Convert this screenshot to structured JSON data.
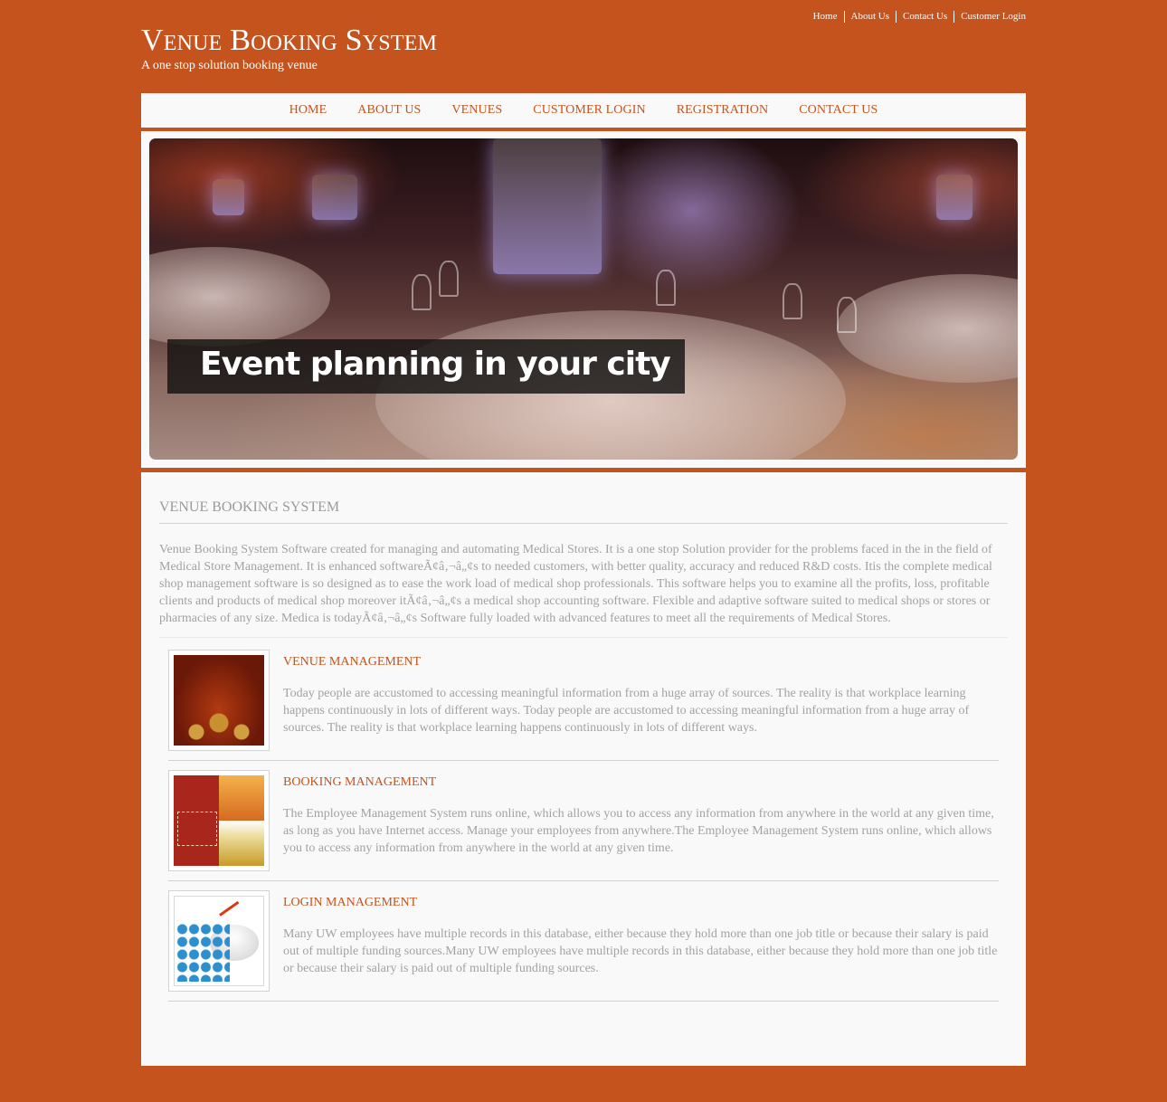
{
  "header": {
    "title": "Venue Booking System",
    "tagline": "A one stop solution booking venue",
    "top_links": [
      "Home",
      "About Us",
      "Contact Us",
      "Customer Login"
    ]
  },
  "nav": {
    "items": [
      "HOME",
      "ABOUT US",
      "VENUES",
      "CUSTOMER LOGIN",
      "REGISTRATION",
      "CONTACT US"
    ]
  },
  "banner": {
    "caption": "Event planning in your city",
    "image": "banquet-hall-photo"
  },
  "main": {
    "title": "VENUE BOOKING SYSTEM",
    "intro": "Venue Booking System Software created for managing and automating Medical Stores. It is a one stop Solution provider for the problems faced in the in the field of Medical Store Management. It is enhanced softwareÃ¢â‚¬â„¢s to needed customers, with better quality, accuracy and reduced R&D costs. Itis the complete medical shop management software is so designed as to ease the work load of medical shop professionals. This software helps you to examine all the profits, loss, profitable clients and products of medical shop moreover itÃ¢â‚¬â„¢s a medical shop accounting software. Flexible and adaptive software suited to medical shops or stores or pharmacies of any size. Medica is todayÃ¢â‚¬â„¢s Software fully loaded with advanced features to meet all the requirements of Medical Stores.",
    "features": [
      {
        "title": "VENUE MANAGEMENT",
        "image": "venue-hall-photo",
        "text": "Today people are accustomed to accessing meaningful information from a huge array of sources. The reality is that workplace learning happens continuously in lots of different ways. Today people are accustomed to accessing meaningful information from a huge array of sources. The reality is that workplace learning happens continuously in lots of different ways."
      },
      {
        "title": "BOOKING MANAGEMENT",
        "image": "venue-booking-collage",
        "text": "The Employee Management System runs online, which allows you to access any information from anywhere in the world at any given time, as long as you have Internet access. Manage your employees from anywhere.The Employee Management System runs online, which allows you to access any information from anywhere in the world at any given time."
      },
      {
        "title": "LOGIN MANAGEMENT",
        "image": "team-leader-chart-illustration",
        "text": "Many UW employees have multiple records in this database, either because they hold more than one job title or because their salary is paid out of multiple funding sources.Many UW employees have multiple records in this database, either because they hold more than one job title or because their salary is paid out of multiple funding sources."
      }
    ]
  },
  "colors": {
    "brand": "#c5531d",
    "panel": "#f9f9f9",
    "body_text": "#a2a2a2"
  }
}
